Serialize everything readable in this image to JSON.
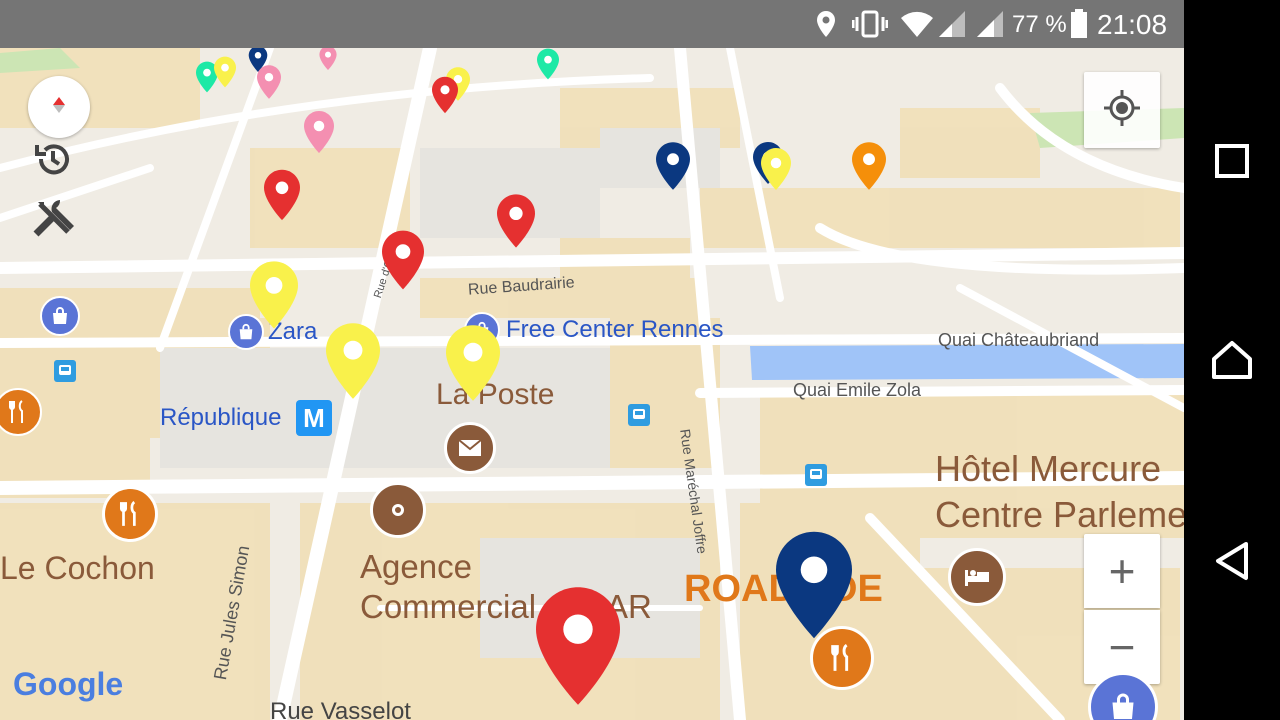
{
  "status_bar": {
    "battery_percent": "77 %",
    "time": "21:08",
    "icons": [
      "location-icon",
      "vibrate-icon",
      "wifi-icon",
      "signal-icon",
      "signal-icon",
      "battery-icon"
    ]
  },
  "map": {
    "attribution": "Google",
    "streets": [
      "Rue Baudrairie",
      "Quai Châteaubriand",
      "Quai Emile Zola",
      "Rue Maréchal Joffre",
      "Rue Jules Simon",
      "Rue Vasselot",
      "Rue d'Orléans"
    ],
    "places": {
      "zara": "Zara",
      "free_center": "Free Center Rennes",
      "republique": "République",
      "la_poste": "La Poste",
      "hotel": [
        "Hôtel Mercure",
        "Centre Parleme"
      ],
      "le_cochon": "Le Cochon",
      "agence": [
        "Agence",
        "Commercial",
        "AR"
      ],
      "road_side": [
        "ROAD",
        "DE"
      ]
    },
    "metro_badge": "M",
    "colors": {
      "pin_red": "#e53030",
      "pin_yellow": "#f9f14b",
      "pin_blue": "#0b3880",
      "pin_pink": "#f48fb1",
      "pin_green": "#1de9a6",
      "pin_orange": "#f58f0a",
      "water": "#a0c4f8",
      "poi_blue": "#2a56c6",
      "poi_brown": "#8a5a3a",
      "poi_orange": "#e0781a"
    }
  },
  "controls": {
    "zoom_in": "+",
    "zoom_out": "−",
    "icons": [
      "compass-icon",
      "history-icon",
      "wrench-tools-icon",
      "my-location-icon",
      "shopping-bag-icon"
    ]
  },
  "nav_bar": {
    "icons": [
      "recents-square-icon",
      "home-icon",
      "back-icon"
    ]
  }
}
